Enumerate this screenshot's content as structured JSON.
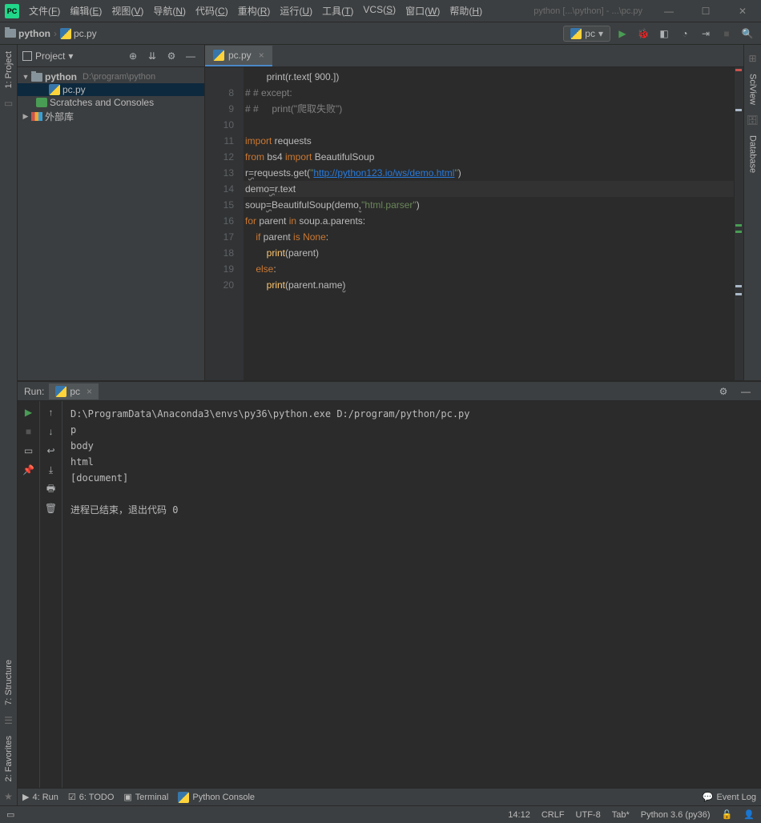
{
  "window": {
    "title": "python [...\\python] - ...\\pc.py"
  },
  "menu": [
    "文件(F)",
    "编辑(E)",
    "视图(V)",
    "导航(N)",
    "代码(C)",
    "重构(R)",
    "运行(U)",
    "工具(T)",
    "VCS(S)",
    "窗口(W)",
    "帮助(H)"
  ],
  "breadcrumb": {
    "root": "python",
    "file": "pc.py"
  },
  "run_config": "pc",
  "project": {
    "title": "Project",
    "root": "python",
    "root_path": "D:\\program\\python",
    "file": "pc.py",
    "scratches": "Scratches and Consoles",
    "external": "外部库"
  },
  "left_strip": {
    "project": "1: Project",
    "structure": "7: Structure",
    "favorites": "2: Favorites"
  },
  "right_strip": {
    "sciview": "SciView",
    "database": "Database"
  },
  "tab": {
    "name": "pc.py"
  },
  "code_lines": [
    {
      "n": "",
      "html": "        print(r.text[ 900.])"
    },
    {
      "n": "8",
      "html": "<span class='com'># # except:</span>"
    },
    {
      "n": "9",
      "html": "<span class='com'># #     print(\"爬取失败\")</span>"
    },
    {
      "n": "10",
      "html": ""
    },
    {
      "n": "11",
      "html": "<span class='kw'>import</span> requests"
    },
    {
      "n": "12",
      "html": "<span class='kw'>from</span> bs4 <span class='kw'>import</span> BeautifulSoup"
    },
    {
      "n": "13",
      "html": "r<span class='warn'>=</span>requests.get(<span class='str'>\"</span><span class='url'>http://python123.io/ws/demo.html</span><span class='str'>\"</span>)"
    },
    {
      "n": "14",
      "html": "demo<span class='warn'>=</span>r.text",
      "hl": true
    },
    {
      "n": "15",
      "html": "soup<span class='warn'>=</span>BeautifulSoup(demo<span class='warn'>,</span><span class='str'>\"html.parser\"</span>)"
    },
    {
      "n": "16",
      "html": "<span class='kw'>for</span> parent <span class='kw'>in</span> soup.a.parents:"
    },
    {
      "n": "17",
      "html": "    <span class='kw'>if</span> parent <span class='kw'>is</span> <span class='kw'>None</span>:"
    },
    {
      "n": "18",
      "html": "        <span class='func'>print</span>(parent)"
    },
    {
      "n": "19",
      "html": "    <span class='kw'>else</span>:"
    },
    {
      "n": "20",
      "html": "        <span class='func'>print</span>(parent.name<span class='warn'>)</span>"
    }
  ],
  "run": {
    "label": "Run:",
    "tab": "pc",
    "output": "D:\\ProgramData\\Anaconda3\\envs\\py36\\python.exe D:/program/python/pc.py\np\nbody\nhtml\n[document]\n\n进程已结束，退出代码 0"
  },
  "bottom": {
    "run": "4: Run",
    "todo": "6: TODO",
    "terminal": "Terminal",
    "pyconsole": "Python Console",
    "eventlog": "Event Log"
  },
  "status": {
    "pos": "14:12",
    "crlf": "CRLF",
    "enc": "UTF-8",
    "indent": "Tab*",
    "interp": "Python 3.6 (py36)"
  }
}
